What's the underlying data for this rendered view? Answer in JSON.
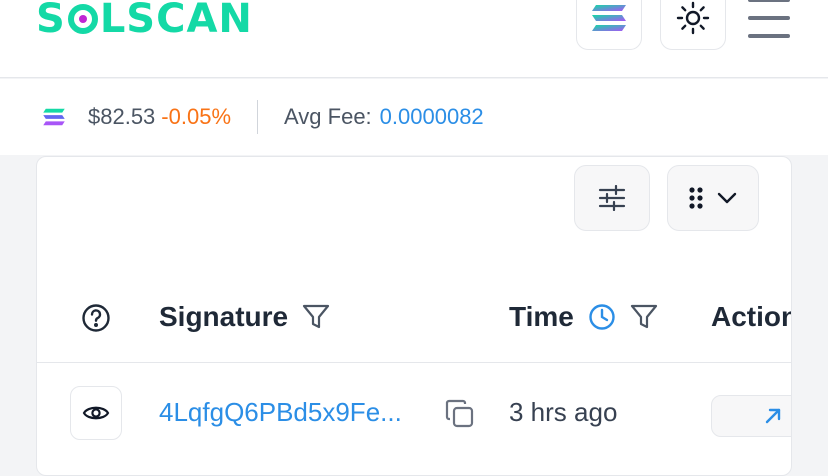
{
  "header": {
    "logo_text": "SOLSCAN",
    "brand_color": "#14d9a6"
  },
  "pricebar": {
    "price": "$82.53",
    "change": "-0.05%",
    "avg_fee_label": "Avg Fee:",
    "avg_fee_value": "0.0000082"
  },
  "table": {
    "columns": [
      "Signature",
      "Time",
      "Action"
    ],
    "rows": [
      {
        "signature": "4LqfgQ6PBd5x9Fe...",
        "time": "3 hrs ago"
      }
    ]
  },
  "icons": [
    "solana-icon",
    "sun-icon",
    "hamburger-menu-icon",
    "sliders-icon",
    "columns-dots-icon",
    "chevron-down-icon",
    "help-circle-icon",
    "filter-icon",
    "clock-icon",
    "eye-icon",
    "copy-icon",
    "arrow-up-right-icon"
  ],
  "colors": {
    "accent": "#2b8ee6",
    "negative": "#f97316"
  }
}
